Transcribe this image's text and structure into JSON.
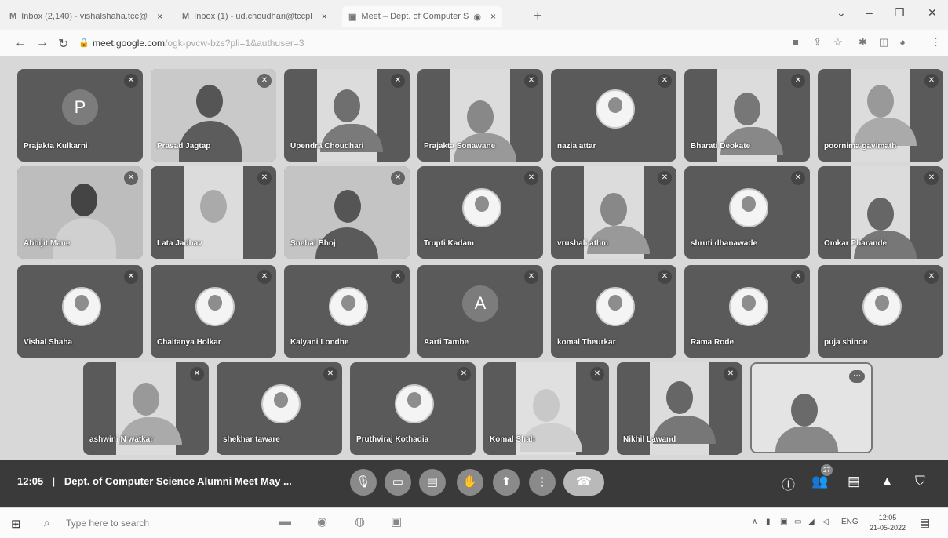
{
  "browser": {
    "tabs": [
      {
        "icon": "M",
        "title": "Inbox (2,140) - vishalshaha.tcc@"
      },
      {
        "icon": "M",
        "title": "Inbox (1) - ud.choudhari@tccpl"
      },
      {
        "icon": "▣",
        "title": "Meet – Dept. of Computer S"
      }
    ],
    "url_host": "meet.google.com",
    "url_path": "/ogk-pvcw-bzs?pli=1&authuser=3"
  },
  "participants_rows": [
    [
      "Prajakta Kulkarni",
      "Prasad Jagtap",
      "Upendra Choudhari",
      "Prajakta Sonawane",
      "nazia attar",
      "Bharati Deokate",
      "poornima gavimath"
    ],
    [
      "Abhijit Mane",
      "Lata Jadhav",
      "Snehal Bhoj",
      "Trupti Kadam",
      "vrushali athm",
      "shruti dhanawade",
      "Omkar Pharande"
    ],
    [
      "Vishal Shaha",
      "Chaitanya Holkar",
      "Kalyani Londhe",
      "Aarti Tambe",
      "komal Theurkar",
      "Rama Rode",
      "puja shinde"
    ],
    [
      "ashwini N watkar",
      "shekhar taware",
      "Pruthviraj Kothadia",
      "Komal Shah",
      "Nikhil Lawand"
    ]
  ],
  "avatar_letters": {
    "prajakta_kulkarni": "P",
    "aarti_tambe": "A"
  },
  "controls": {
    "time": "12:05",
    "separator": "|",
    "meeting_title": "Dept. of Computer Science Alumni Meet May ...",
    "participant_count": "27"
  },
  "taskbar": {
    "search_placeholder": "Type here to search",
    "language": "ENG",
    "time": "12:05",
    "date": "21-05-2022"
  }
}
